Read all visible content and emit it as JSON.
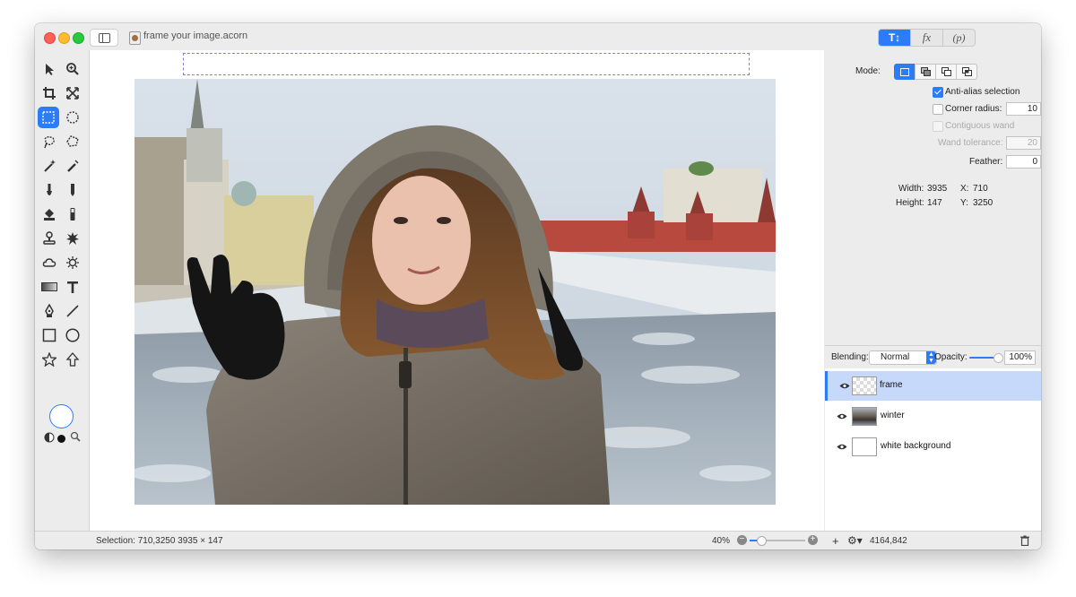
{
  "window": {
    "title": "frame your image.acorn"
  },
  "inspector_tabs": [
    {
      "label": "T",
      "icon": "text-tools-icon"
    },
    {
      "label": "fx",
      "icon": "filters-icon"
    },
    {
      "label": "(p)",
      "icon": "plugins-icon"
    }
  ],
  "tools": [
    {
      "name": "select-arrow-tool"
    },
    {
      "name": "zoom-tool"
    },
    {
      "name": "crop-tool"
    },
    {
      "name": "resize-tool"
    },
    {
      "name": "rect-marquee-tool",
      "selected": true
    },
    {
      "name": "ellipse-marquee-tool"
    },
    {
      "name": "lasso-tool"
    },
    {
      "name": "polygon-lasso-tool"
    },
    {
      "name": "magic-wand-tool"
    },
    {
      "name": "color-wand-tool"
    },
    {
      "name": "brush-tool"
    },
    {
      "name": "pencil-tool"
    },
    {
      "name": "paint-bucket-tool"
    },
    {
      "name": "eraser-tool"
    },
    {
      "name": "clone-stamp-tool"
    },
    {
      "name": "blur-tool"
    },
    {
      "name": "cloud-tool"
    },
    {
      "name": "dodge-burn-tool"
    },
    {
      "name": "gradient-tool"
    },
    {
      "name": "text-tool"
    },
    {
      "name": "bezier-pen-tool"
    },
    {
      "name": "line-tool"
    },
    {
      "name": "rectangle-shape-tool"
    },
    {
      "name": "oval-shape-tool"
    },
    {
      "name": "star-shape-tool"
    },
    {
      "name": "arrow-shape-tool"
    }
  ],
  "inspector": {
    "mode_label": "Mode:",
    "anti_alias": {
      "label": "Anti-alias selection",
      "checked": true
    },
    "corner_radius": {
      "label": "Corner radius:",
      "value": "10",
      "checked": false
    },
    "contiguous_wand": {
      "label": "Contiguous wand",
      "enabled": false
    },
    "wand_tolerance": {
      "label": "Wand tolerance:",
      "value": "20"
    },
    "feather": {
      "label": "Feather:",
      "value": "0"
    },
    "width_label": "Width:",
    "width": "3935",
    "height_label": "Height:",
    "height": "147",
    "x_label": "X:",
    "x": "710",
    "y_label": "Y:",
    "y": "3250"
  },
  "blend": {
    "blending_label": "Blending:",
    "mode": "Normal",
    "opacity_label": "Opacity:",
    "opacity": "100%",
    "opacity_value": 1.0
  },
  "layers": [
    {
      "name": "frame",
      "selected": true,
      "thumb": "transparent"
    },
    {
      "name": "winter",
      "selected": false,
      "thumb": "photo"
    },
    {
      "name": "white background",
      "selected": false,
      "thumb": "white"
    }
  ],
  "status": {
    "selection": "Selection: 710,3250 3935 × 147",
    "zoom": "40%",
    "canvas_size": "4164,842"
  },
  "colors": {
    "accent": "#2b7cf6",
    "selection_marquee": "#8a7fd6"
  }
}
